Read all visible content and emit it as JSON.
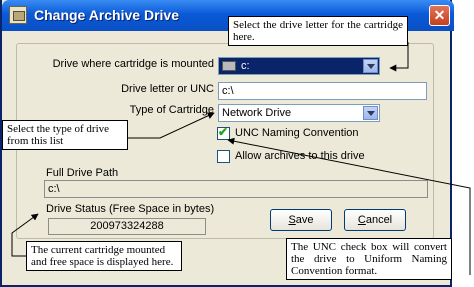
{
  "window": {
    "title": "Change Archive Drive",
    "close_glyph": "✕"
  },
  "form": {
    "drive_label": "Drive where cartridge is mounted",
    "drive_value": "c:",
    "letter_label": "Drive letter or UNC",
    "letter_value": "c:\\",
    "type_label": "Type of Cartridge",
    "type_value": "Network Drive",
    "unc_label": "UNC Naming Convention",
    "unc_checked": true,
    "allow_label": "Allow archives to this drive",
    "allow_checked": false,
    "path_label": "Full Drive Path",
    "path_value": "c:\\",
    "status_label": "Drive Status (Free Space in bytes)",
    "status_value": "200973324288",
    "save_hotkey": "S",
    "save_rest": "ave",
    "cancel_hotkey": "C",
    "cancel_rest": "ancel"
  },
  "callouts": {
    "drive": "Select the drive letter for the cartridge here.",
    "type": "Select the type of drive from this list",
    "status": "The current cartridge mounted and free space is displayed here.",
    "unc": "The UNC check box will convert the drive to Uniform Naming Convention format."
  }
}
